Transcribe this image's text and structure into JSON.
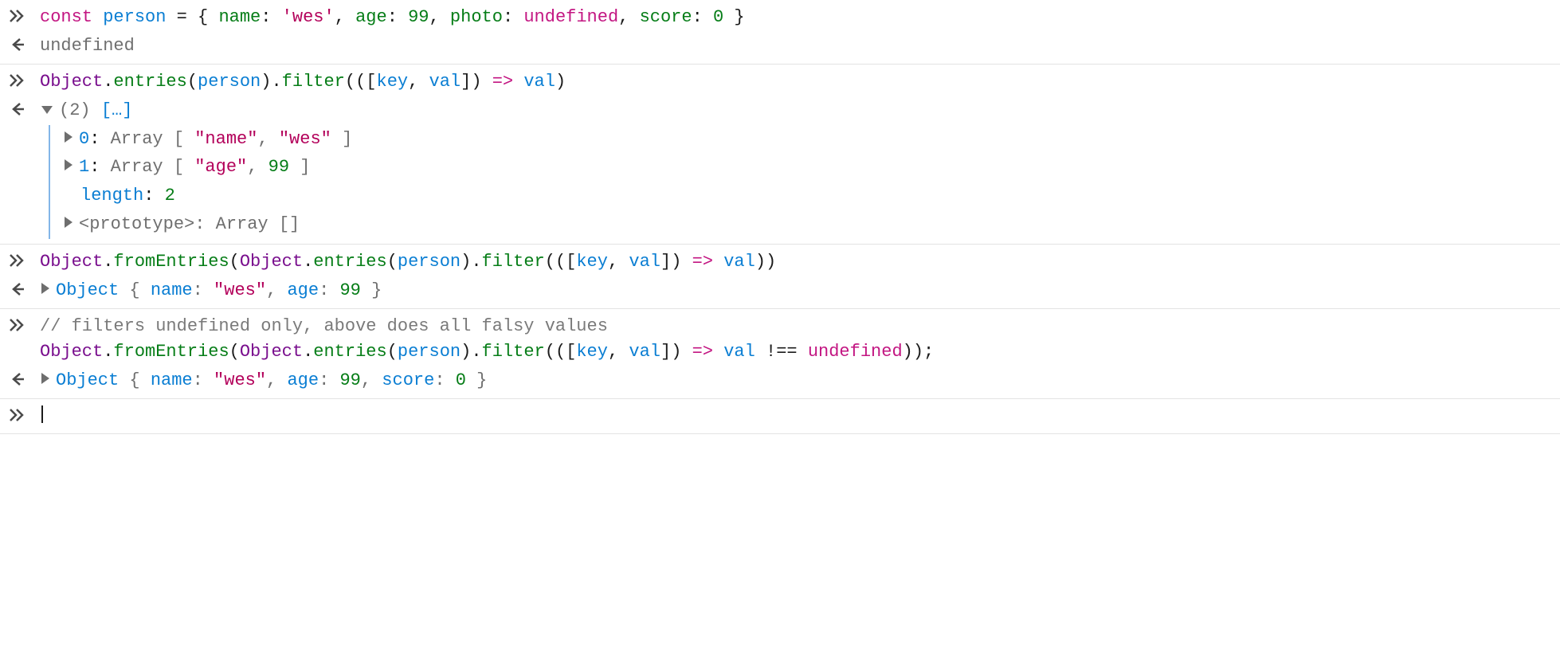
{
  "entries": [
    {
      "kind": "input",
      "tokens": [
        {
          "c": "kw",
          "t": "const "
        },
        {
          "c": "def",
          "t": "person"
        },
        {
          "c": "punct",
          "t": " = { "
        },
        {
          "c": "prop",
          "t": "name"
        },
        {
          "c": "punct",
          "t": ": "
        },
        {
          "c": "str",
          "t": "'wes'"
        },
        {
          "c": "punct",
          "t": ", "
        },
        {
          "c": "prop",
          "t": "age"
        },
        {
          "c": "punct",
          "t": ": "
        },
        {
          "c": "num",
          "t": "99"
        },
        {
          "c": "punct",
          "t": ", "
        },
        {
          "c": "prop",
          "t": "photo"
        },
        {
          "c": "punct",
          "t": ": "
        },
        {
          "c": "kw",
          "t": "undefined"
        },
        {
          "c": "punct",
          "t": ", "
        },
        {
          "c": "prop",
          "t": "score"
        },
        {
          "c": "punct",
          "t": ": "
        },
        {
          "c": "num",
          "t": "0"
        },
        {
          "c": "punct",
          "t": " }"
        }
      ]
    },
    {
      "kind": "output",
      "tokens": [
        {
          "c": "muted",
          "t": "undefined"
        }
      ]
    },
    {
      "kind": "input",
      "tokens": [
        {
          "c": "objword",
          "t": "Object"
        },
        {
          "c": "punct",
          "t": "."
        },
        {
          "c": "prop",
          "t": "entries"
        },
        {
          "c": "punct",
          "t": "("
        },
        {
          "c": "def",
          "t": "person"
        },
        {
          "c": "punct",
          "t": ")."
        },
        {
          "c": "prop",
          "t": "filter"
        },
        {
          "c": "punct",
          "t": "(("
        },
        {
          "c": "punct",
          "t": "["
        },
        {
          "c": "def",
          "t": "key"
        },
        {
          "c": "punct",
          "t": ", "
        },
        {
          "c": "def",
          "t": "val"
        },
        {
          "c": "punct",
          "t": "]"
        },
        {
          "c": "punct",
          "t": ") "
        },
        {
          "c": "kw",
          "t": "=>"
        },
        {
          "c": "punct",
          "t": " "
        },
        {
          "c": "def",
          "t": "val"
        },
        {
          "c": "punct",
          "t": ")"
        }
      ]
    },
    {
      "kind": "output-tree",
      "header": {
        "count": "(2)",
        "more": "[…]"
      },
      "rows": [
        {
          "twisty": true,
          "tokens": [
            {
              "c": "blue",
              "t": "0"
            },
            {
              "c": "punct",
              "t": ": "
            },
            {
              "c": "muted",
              "t": "Array [ "
            },
            {
              "c": "str",
              "t": "\"name\""
            },
            {
              "c": "muted",
              "t": ", "
            },
            {
              "c": "str",
              "t": "\"wes\""
            },
            {
              "c": "muted",
              "t": " ]"
            }
          ]
        },
        {
          "twisty": true,
          "tokens": [
            {
              "c": "blue",
              "t": "1"
            },
            {
              "c": "punct",
              "t": ": "
            },
            {
              "c": "muted",
              "t": "Array [ "
            },
            {
              "c": "str",
              "t": "\"age\""
            },
            {
              "c": "muted",
              "t": ", "
            },
            {
              "c": "num",
              "t": "99"
            },
            {
              "c": "muted",
              "t": " ]"
            }
          ]
        },
        {
          "twisty": false,
          "tokens": [
            {
              "c": "blue",
              "t": "length"
            },
            {
              "c": "punct",
              "t": ": "
            },
            {
              "c": "num",
              "t": "2"
            }
          ]
        },
        {
          "twisty": true,
          "tokens": [
            {
              "c": "muted",
              "t": "<prototype>: Array []"
            }
          ]
        }
      ]
    },
    {
      "kind": "input",
      "tokens": [
        {
          "c": "objword",
          "t": "Object"
        },
        {
          "c": "punct",
          "t": "."
        },
        {
          "c": "prop",
          "t": "fromEntries"
        },
        {
          "c": "punct",
          "t": "("
        },
        {
          "c": "objword",
          "t": "Object"
        },
        {
          "c": "punct",
          "t": "."
        },
        {
          "c": "prop",
          "t": "entries"
        },
        {
          "c": "punct",
          "t": "("
        },
        {
          "c": "def",
          "t": "person"
        },
        {
          "c": "punct",
          "t": ")."
        },
        {
          "c": "prop",
          "t": "filter"
        },
        {
          "c": "punct",
          "t": "(("
        },
        {
          "c": "punct",
          "t": "["
        },
        {
          "c": "def",
          "t": "key"
        },
        {
          "c": "punct",
          "t": ", "
        },
        {
          "c": "def",
          "t": "val"
        },
        {
          "c": "punct",
          "t": "]"
        },
        {
          "c": "punct",
          "t": ") "
        },
        {
          "c": "kw",
          "t": "=>"
        },
        {
          "c": "punct",
          "t": " "
        },
        {
          "c": "def",
          "t": "val"
        },
        {
          "c": "punct",
          "t": "))"
        }
      ]
    },
    {
      "kind": "output-inline",
      "tokens": [
        {
          "c": "blue",
          "t": "Object "
        },
        {
          "c": "muted",
          "t": "{ "
        },
        {
          "c": "blue",
          "t": "name"
        },
        {
          "c": "muted",
          "t": ": "
        },
        {
          "c": "str",
          "t": "\"wes\""
        },
        {
          "c": "muted",
          "t": ", "
        },
        {
          "c": "blue",
          "t": "age"
        },
        {
          "c": "muted",
          "t": ": "
        },
        {
          "c": "num",
          "t": "99"
        },
        {
          "c": "muted",
          "t": " }"
        }
      ]
    },
    {
      "kind": "input-multiline",
      "lines": [
        [
          {
            "c": "comment",
            "t": "// filters undefined only, above does all falsy values"
          }
        ],
        [
          {
            "c": "objword",
            "t": "Object"
          },
          {
            "c": "punct",
            "t": "."
          },
          {
            "c": "prop",
            "t": "fromEntries"
          },
          {
            "c": "punct",
            "t": "("
          },
          {
            "c": "objword",
            "t": "Object"
          },
          {
            "c": "punct",
            "t": "."
          },
          {
            "c": "prop",
            "t": "entries"
          },
          {
            "c": "punct",
            "t": "("
          },
          {
            "c": "def",
            "t": "person"
          },
          {
            "c": "punct",
            "t": ")."
          },
          {
            "c": "prop",
            "t": "filter"
          },
          {
            "c": "punct",
            "t": "(("
          },
          {
            "c": "punct",
            "t": "["
          },
          {
            "c": "def",
            "t": "key"
          },
          {
            "c": "punct",
            "t": ", "
          },
          {
            "c": "def",
            "t": "val"
          },
          {
            "c": "punct",
            "t": "]"
          },
          {
            "c": "punct",
            "t": ") "
          },
          {
            "c": "kw",
            "t": "=>"
          },
          {
            "c": "punct",
            "t": " "
          },
          {
            "c": "def",
            "t": "val"
          },
          {
            "c": "punct",
            "t": " !== "
          },
          {
            "c": "kw",
            "t": "undefined"
          },
          {
            "c": "punct",
            "t": "));"
          }
        ]
      ]
    },
    {
      "kind": "output-inline",
      "tokens": [
        {
          "c": "blue",
          "t": "Object "
        },
        {
          "c": "muted",
          "t": "{ "
        },
        {
          "c": "blue",
          "t": "name"
        },
        {
          "c": "muted",
          "t": ": "
        },
        {
          "c": "str",
          "t": "\"wes\""
        },
        {
          "c": "muted",
          "t": ", "
        },
        {
          "c": "blue",
          "t": "age"
        },
        {
          "c": "muted",
          "t": ": "
        },
        {
          "c": "num",
          "t": "99"
        },
        {
          "c": "muted",
          "t": ", "
        },
        {
          "c": "blue",
          "t": "score"
        },
        {
          "c": "muted",
          "t": ": "
        },
        {
          "c": "num",
          "t": "0"
        },
        {
          "c": "muted",
          "t": " }"
        }
      ]
    },
    {
      "kind": "prompt"
    }
  ]
}
